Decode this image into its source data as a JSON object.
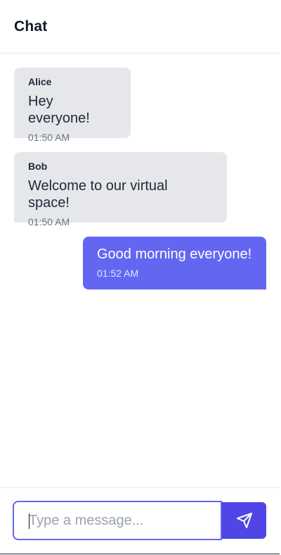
{
  "header": {
    "title": "Chat"
  },
  "messages": [
    {
      "sender": "Alice",
      "text": "Hey everyone!",
      "time": "01:50 AM",
      "direction": "incoming"
    },
    {
      "sender": "Bob",
      "text": "Welcome to our virtual space!",
      "time": "01:50 AM",
      "direction": "incoming"
    },
    {
      "sender": "",
      "text": "Good morning everyone!",
      "time": "01:52 AM",
      "direction": "outgoing"
    }
  ],
  "composer": {
    "placeholder": "Type a message...",
    "value": "",
    "send_icon": "send-icon"
  },
  "colors": {
    "accent": "#6366f1",
    "send_button": "#4f46e5",
    "incoming_bubble": "#e5e7eb"
  }
}
